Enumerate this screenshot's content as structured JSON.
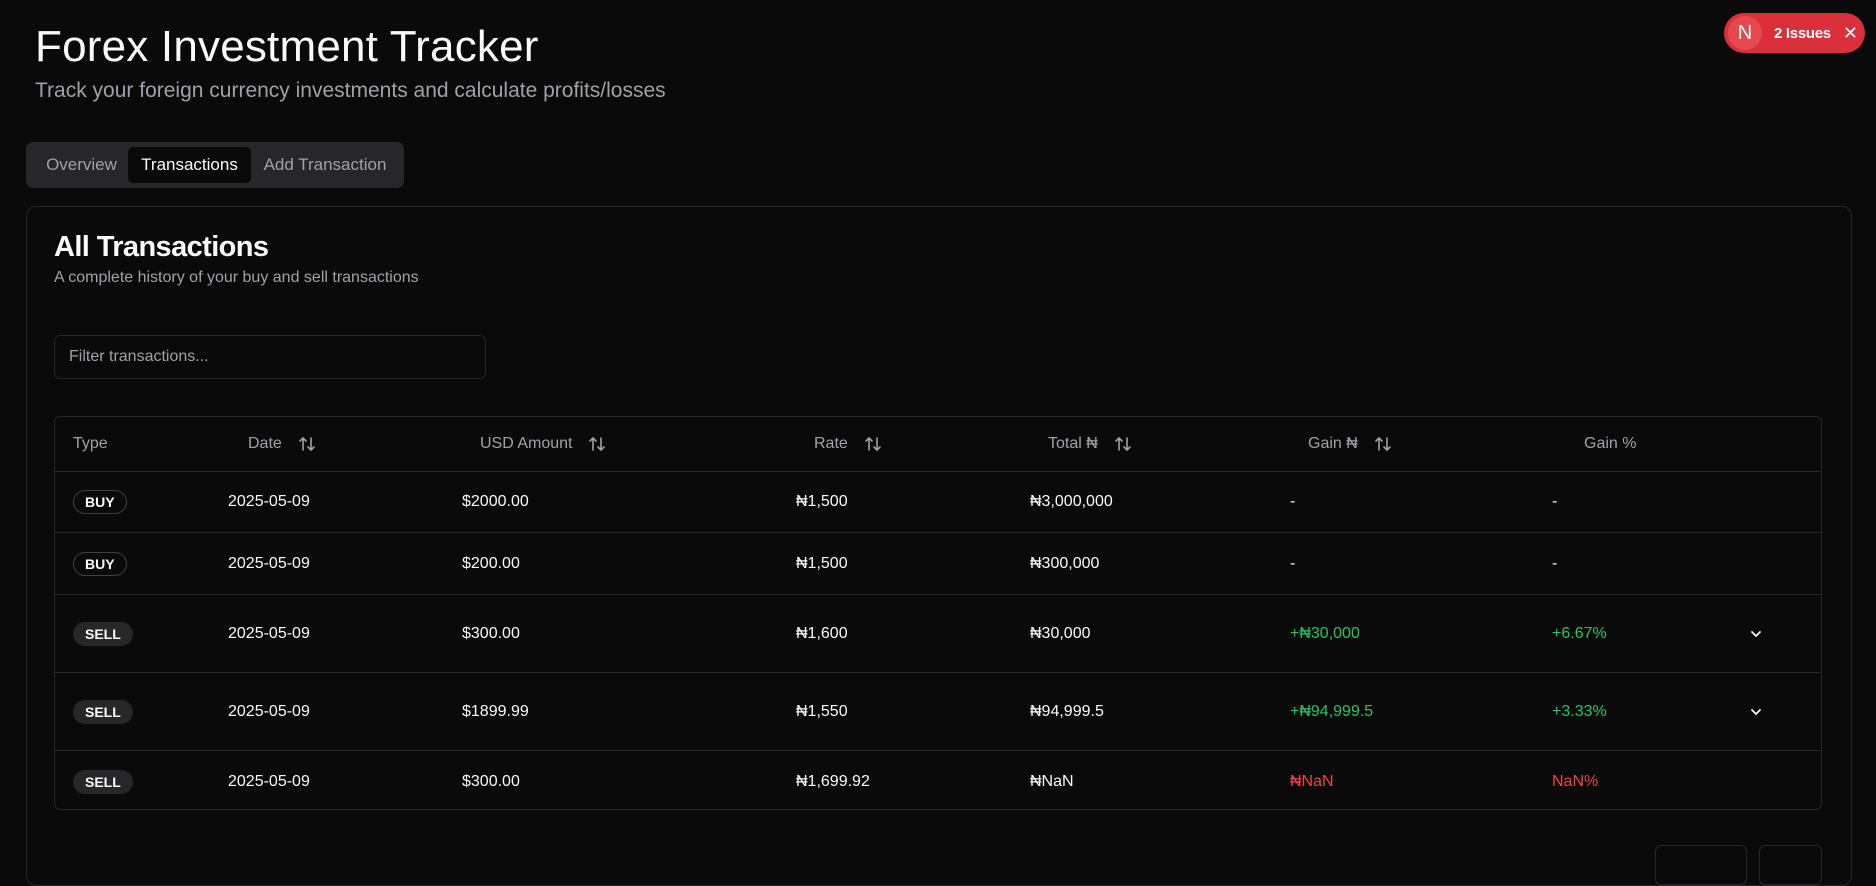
{
  "header": {
    "title": "Forex Investment Tracker",
    "subtitle": "Track your foreign currency investments and calculate profits/losses"
  },
  "issues_badge": {
    "logo_letter": "N",
    "label": "2 Issues",
    "close_glyph": "✕",
    "color": "#dc2f3c"
  },
  "tabs": [
    {
      "label": "Overview",
      "active": false
    },
    {
      "label": "Transactions",
      "active": true
    },
    {
      "label": "Add Transaction",
      "active": false
    }
  ],
  "card": {
    "title": "All Transactions",
    "description": "A complete history of your buy and sell transactions",
    "filter_placeholder": "Filter transactions..."
  },
  "table": {
    "columns": [
      {
        "label": "Type",
        "sortable": false
      },
      {
        "label": "Date",
        "sortable": true
      },
      {
        "label": "USD Amount",
        "sortable": true
      },
      {
        "label": "Rate",
        "sortable": true
      },
      {
        "label": "Total ₦",
        "sortable": true
      },
      {
        "label": "Gain ₦",
        "sortable": true
      },
      {
        "label": "Gain %",
        "sortable": false
      }
    ],
    "rows": [
      {
        "type": "BUY",
        "date": "2025-05-09",
        "usd": "$2000.00",
        "rate": "₦1,500",
        "total": "₦3,000,000",
        "gain": "-",
        "gain_pct": "-",
        "status": "none",
        "expandable": false
      },
      {
        "type": "BUY",
        "date": "2025-05-09",
        "usd": "$200.00",
        "rate": "₦1,500",
        "total": "₦300,000",
        "gain": "-",
        "gain_pct": "-",
        "status": "none",
        "expandable": false
      },
      {
        "type": "SELL",
        "date": "2025-05-09",
        "usd": "$300.00",
        "rate": "₦1,600",
        "total": "₦30,000",
        "gain": "+₦30,000",
        "gain_pct": "+6.67%",
        "status": "positive",
        "expandable": true
      },
      {
        "type": "SELL",
        "date": "2025-05-09",
        "usd": "$1899.99",
        "rate": "₦1,550",
        "total": "₦94,999.5",
        "gain": "+₦94,999.5",
        "gain_pct": "+3.33%",
        "status": "positive",
        "expandable": true
      },
      {
        "type": "SELL",
        "date": "2025-05-09",
        "usd": "$300.00",
        "rate": "₦1,699.92",
        "total": "₦NaN",
        "gain": "₦NaN",
        "gain_pct": "NaN%",
        "status": "negative",
        "expandable": false
      }
    ]
  },
  "icons": {
    "sort": "sort-arrows-icon",
    "expand": "chevron-down-icon"
  },
  "colors": {
    "background": "#0a0a0a",
    "positive": "#22c55e",
    "negative": "#ef4444",
    "border": "#27272a"
  }
}
